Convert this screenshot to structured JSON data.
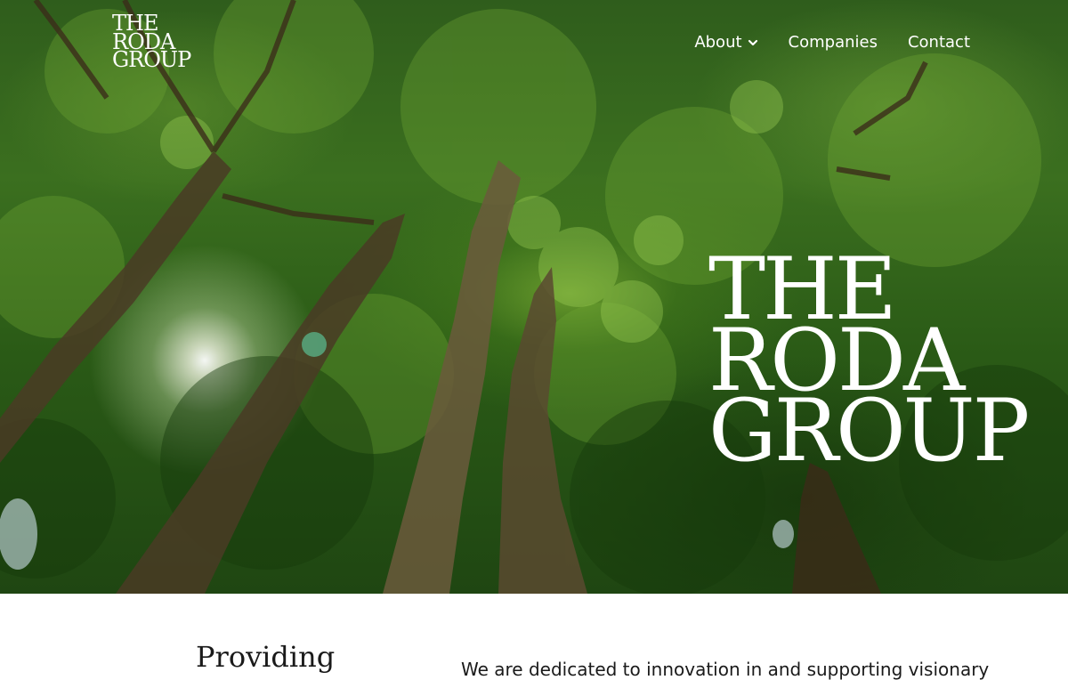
{
  "brand": {
    "logo_lines": [
      "THE",
      "RODA",
      "GROUP"
    ]
  },
  "nav": {
    "items": [
      {
        "label": "About",
        "has_dropdown": true
      },
      {
        "label": "Companies",
        "has_dropdown": false
      },
      {
        "label": "Contact",
        "has_dropdown": false
      }
    ]
  },
  "hero": {
    "title_lines": [
      "THE",
      "RODA",
      "GROUP"
    ]
  },
  "section": {
    "heading": "Providing",
    "intro_text": "We are dedicated to innovation in and supporting visionary"
  },
  "colors": {
    "nav_text": "#ffffff",
    "canopy_dark": "#1f4612",
    "canopy_light": "#8fc24a",
    "body_text": "#1a1a1a"
  }
}
